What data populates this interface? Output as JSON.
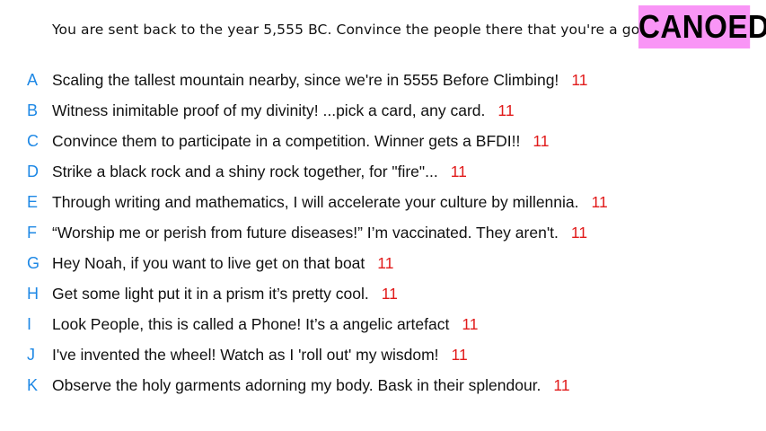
{
  "prompt": "You are sent back to the year 5,555 BC. Convince the people there that you're a god.",
  "stamp": "CANOED",
  "colors": {
    "stamp_background": "#f995f6",
    "letter": "#1e88e5",
    "score": "#e11b1b"
  },
  "options": [
    {
      "letter": "A",
      "text": "Scaling the tallest mountain nearby, since we're in 5555 Before Climbing!",
      "score": "11"
    },
    {
      "letter": "B",
      "text": "Witness inimitable proof of my divinity! ...pick a card, any card.",
      "score": "11"
    },
    {
      "letter": "C",
      "text": "Convince them to participate in a competition. Winner gets a BFDI!!",
      "score": "11"
    },
    {
      "letter": "D",
      "text": "Strike a black rock and a shiny rock together, for \"fire\"...",
      "score": "11"
    },
    {
      "letter": "E",
      "text": "Through writing and mathematics, I will accelerate your culture by millennia.",
      "score": "11"
    },
    {
      "letter": "F",
      "text": "“Worship me or perish from future diseases!” I’m vaccinated. They aren't.",
      "score": "11"
    },
    {
      "letter": "G",
      "text": "Hey Noah, if you want to live get on that boat",
      "score": "11"
    },
    {
      "letter": "H",
      "text": "Get some light put it in a prism it’s pretty cool.",
      "score": "11"
    },
    {
      "letter": "I",
      "text": "Look People, this is called a Phone! It’s a angelic artefact",
      "score": "11"
    },
    {
      "letter": "J",
      "text": "I've invented the wheel! Watch as I 'roll out' my wisdom!",
      "score": "11"
    },
    {
      "letter": "K",
      "text": "Observe the holy garments adorning my body. Bask in their splendour.",
      "score": "11"
    }
  ]
}
